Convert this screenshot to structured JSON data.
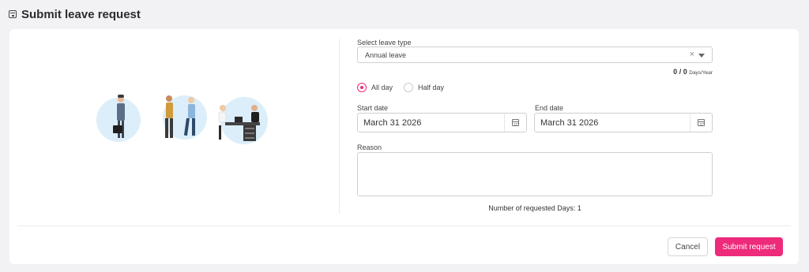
{
  "header": {
    "title": "Submit leave request",
    "icon": "calendar-icon"
  },
  "form": {
    "leave_type": {
      "label": "Select leave type",
      "value": "Annual leave",
      "clear_glyph": "×"
    },
    "quota": {
      "used": "0",
      "separator": "/",
      "total": "0",
      "unit": "Days/Year"
    },
    "duration": {
      "options": [
        {
          "label": "All day",
          "checked": true
        },
        {
          "label": "Half day",
          "checked": false
        }
      ]
    },
    "start_date": {
      "label": "Start date",
      "value": "March 31 2026"
    },
    "end_date": {
      "label": "End date",
      "value": "March 31 2026"
    },
    "reason": {
      "label": "Reason",
      "value": ""
    },
    "requested_days": "Number of requested Days: 1"
  },
  "actions": {
    "cancel_label": "Cancel",
    "submit_label": "Submit request"
  },
  "colors": {
    "accent": "#ee2a7b",
    "background": "#f2f2f4",
    "card": "#ffffff"
  }
}
